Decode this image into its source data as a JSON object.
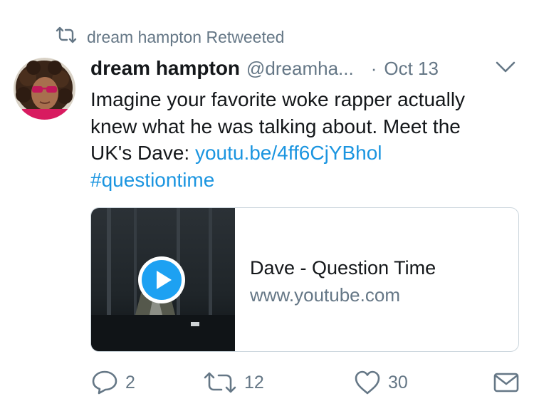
{
  "retweet_context": {
    "icon": "retweet-icon",
    "text": "dream hampton Retweeted"
  },
  "author": {
    "display_name": "dream hampton",
    "handle": "@dreamha...",
    "separator": "·",
    "date": "Oct 13",
    "avatar_icon": "avatar"
  },
  "tweet": {
    "lines": [
      "Imagine your favorite woke rapper actually",
      "knew what he was talking about. Meet the"
    ],
    "line3_prefix": "UK's Dave: ",
    "link_text": "youtu.be/4ff6CjYBhol",
    "hashtag": "#questiontime"
  },
  "card": {
    "title": "Dave - Question Time",
    "domain": "www.youtube.com",
    "play_icon": "play-icon"
  },
  "actions": {
    "reply_count": "2",
    "retweet_count": "12",
    "like_count": "30",
    "reply_icon": "reply-icon",
    "retweet_icon": "retweet-icon",
    "like_icon": "heart-icon",
    "dm_icon": "envelope-icon"
  },
  "colors": {
    "link": "#1b95e0",
    "secondary_text": "#657786",
    "primary_text": "#14171a",
    "border": "#ccd6dd"
  }
}
